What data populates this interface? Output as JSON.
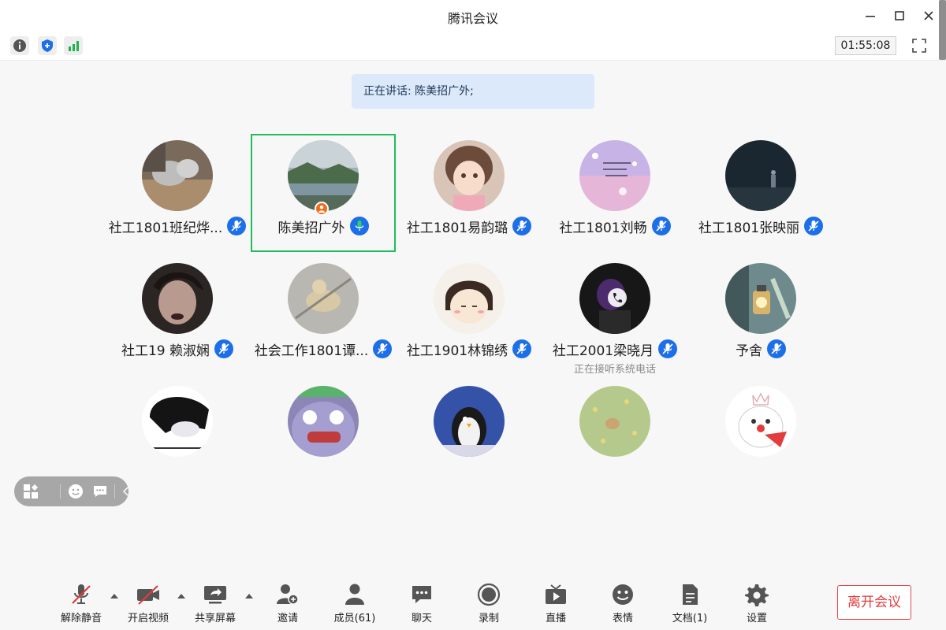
{
  "window": {
    "title": "腾讯会议"
  },
  "top": {
    "timer": "01:55:08"
  },
  "speaking": {
    "text": "正在讲话: 陈美招广外;"
  },
  "participants": [
    {
      "name": "社工1801班纪烨...",
      "mic": "muted",
      "status": ""
    },
    {
      "name": "陈美招广外",
      "mic": "active",
      "status": "",
      "host": true
    },
    {
      "name": "社工1801易韵璐",
      "mic": "muted",
      "status": ""
    },
    {
      "name": "社工1801刘畅",
      "mic": "muted",
      "status": ""
    },
    {
      "name": "社工1801张映丽",
      "mic": "muted",
      "status": ""
    },
    {
      "name": "社工19 赖淑娴",
      "mic": "muted",
      "status": ""
    },
    {
      "name": "社会工作1801谭...",
      "mic": "muted",
      "status": ""
    },
    {
      "name": "社工1901林锦绣",
      "mic": "muted",
      "status": ""
    },
    {
      "name": "社工2001梁晓月",
      "mic": "muted",
      "status": "正在接听系统电话"
    },
    {
      "name": "予舍",
      "mic": "muted",
      "status": ""
    },
    {
      "name": "",
      "mic": "",
      "status": ""
    },
    {
      "name": "",
      "mic": "",
      "status": ""
    },
    {
      "name": "",
      "mic": "",
      "status": ""
    },
    {
      "name": "",
      "mic": "",
      "status": ""
    },
    {
      "name": "",
      "mic": "",
      "status": ""
    }
  ],
  "bottom": {
    "unmute": "解除静音",
    "video": "开启视频",
    "share": "共享屏幕",
    "invite": "邀请",
    "members": "成员(61)",
    "chat": "聊天",
    "record": "录制",
    "live": "直播",
    "emoji": "表情",
    "docs": "文档(1)",
    "settings": "设置",
    "leave": "离开会议"
  },
  "colors": {
    "accent_blue": "#1c6fe8",
    "active_green": "#1fbe5a",
    "leave_red": "#e23c3c"
  }
}
